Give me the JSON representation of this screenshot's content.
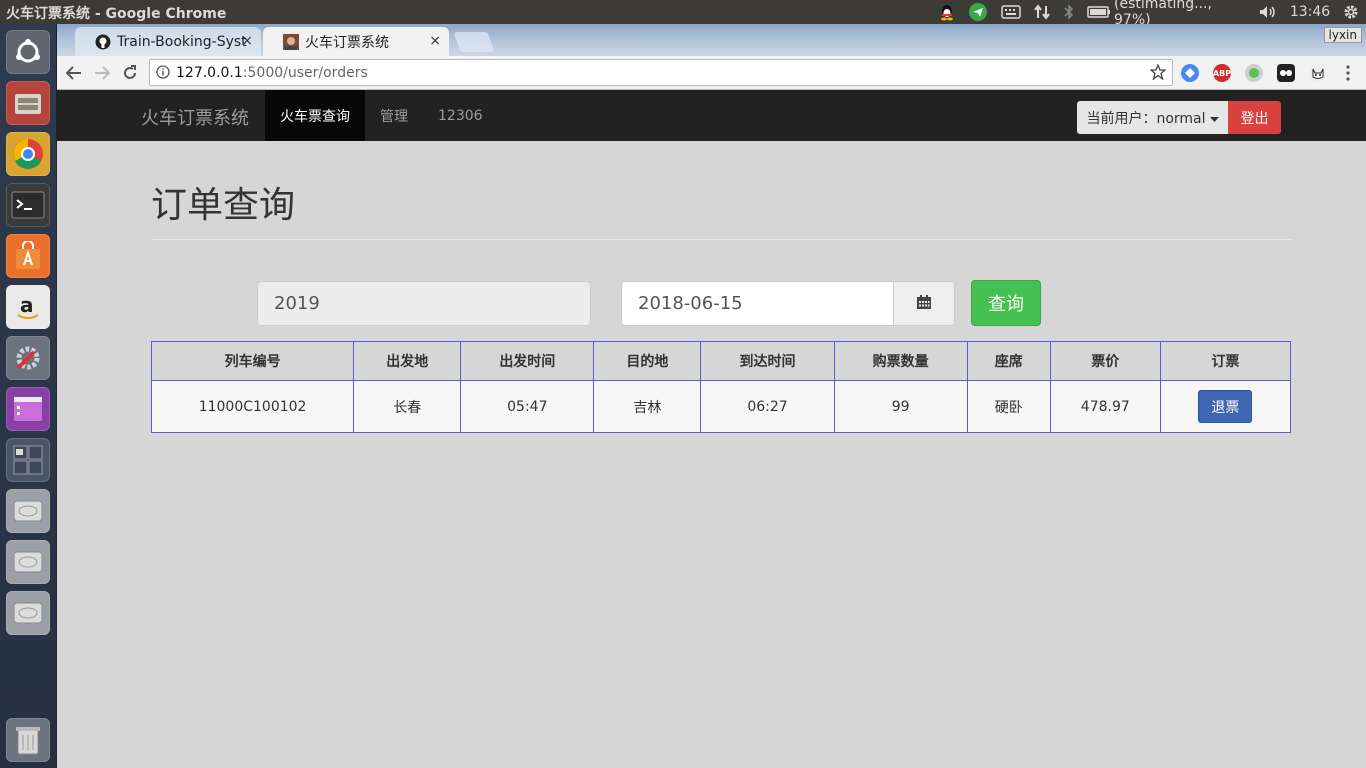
{
  "os": {
    "window_title": "火车订票系统 - Google Chrome",
    "battery_text": "(estimating..., 97%)",
    "clock": "13:46"
  },
  "browser": {
    "tabs": [
      {
        "label": "Train-Booking-Syste",
        "close": "×"
      },
      {
        "label": "火车订票系统",
        "close": "×"
      }
    ],
    "profile_badge": "lyxin",
    "url_host": "127.0.0.1",
    "url_path": ":5000/user/orders",
    "abp_label": "ABP"
  },
  "navbar": {
    "brand": "火车订票系统",
    "links": [
      "火车票查询",
      "管理",
      "12306"
    ],
    "user_dropdown": "当前用户：normal",
    "logout": "登出"
  },
  "main": {
    "title": "订单查询",
    "train_input_value": "2019",
    "date_input_value": "2018-06-15",
    "query_button": "查询"
  },
  "table": {
    "headers": [
      "列车编号",
      "出发地",
      "出发时间",
      "目的地",
      "到达时间",
      "购票数量",
      "座席",
      "票价",
      "订票"
    ],
    "rows": [
      {
        "train_no": "11000C100102",
        "from": "长春",
        "depart_time": "05:47",
        "to": "吉林",
        "arrive_time": "06:27",
        "quantity": "99",
        "seat": "硬卧",
        "price": "478.97",
        "action": "退票"
      }
    ]
  },
  "colors": {
    "navbar_bg": "#222222",
    "logout_red": "#d9413e",
    "query_green": "#45c152",
    "refund_blue": "#3f67b4",
    "table_border": "#5b5bd6"
  }
}
